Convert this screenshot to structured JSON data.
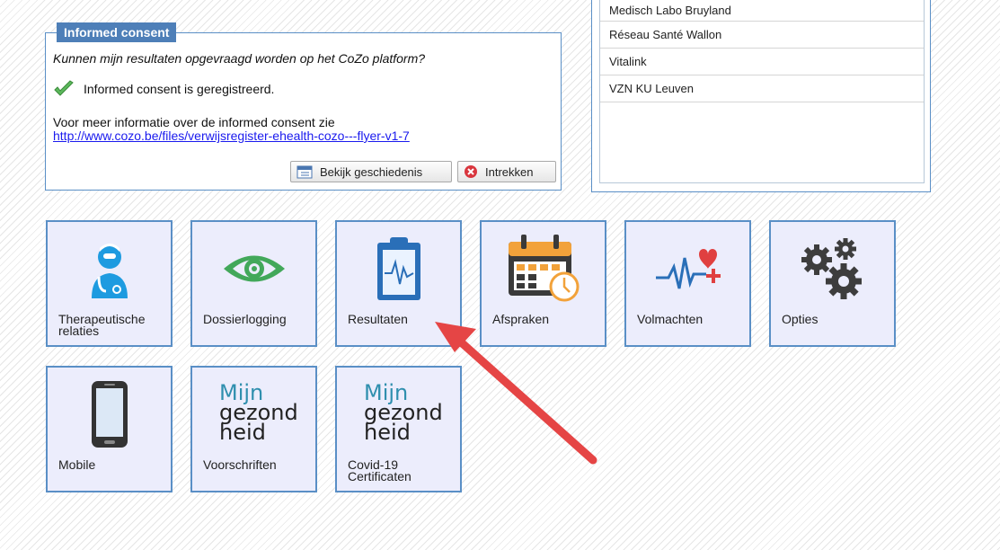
{
  "consent": {
    "legend": "Informed consent",
    "question": "Kunnen mijn resultaten opgevraagd worden op het CoZo platform?",
    "status": "Informed consent is geregistreerd.",
    "info": "Voor meer informatie over de informed consent zie",
    "link": "http://www.cozo.be/files/verwijsregister-ehealth-cozo---flyer-v1-7",
    "history_button": "Bekijk geschiedenis",
    "revoke_button": "Intrekken"
  },
  "providers": [
    "Medisch Labo Bruyland",
    "Réseau Santé Wallon",
    "Vitalink",
    "VZN KU Leuven"
  ],
  "tiles": [
    {
      "label": "Therapeutische relaties",
      "icon": "doctor-icon"
    },
    {
      "label": "Dossierlogging",
      "icon": "eye-icon"
    },
    {
      "label": "Resultaten",
      "icon": "clipboard-icon"
    },
    {
      "label": "Afspraken",
      "icon": "calendar-icon"
    },
    {
      "label": "Volmachten",
      "icon": "heartbeat-icon"
    },
    {
      "label": "Opties",
      "icon": "gears-icon"
    },
    {
      "label": "Mobile",
      "icon": "smartphone-icon"
    },
    {
      "label": "Voorschriften",
      "icon": "mijn-gezondheid-logo"
    },
    {
      "label": "Covid-19 Certificaten",
      "icon": "mijn-gezondheid-logo"
    }
  ],
  "logo_text": {
    "mijn": "Mijn",
    "gezond": "gezond",
    "heid": "heid"
  },
  "colors": {
    "tile_bg": "#ecedfc",
    "tile_border": "#5a8fc6",
    "legend_bg": "#4e7fb8",
    "arrow": "#e54545",
    "link": "#1a1aee"
  }
}
